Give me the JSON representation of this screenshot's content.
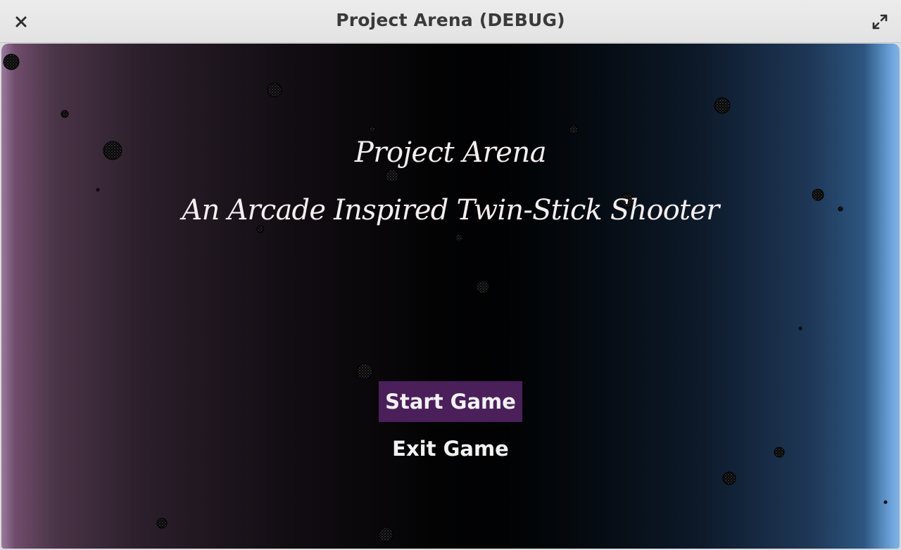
{
  "window": {
    "title": "Project Arena (DEBUG)"
  },
  "titlebar": {
    "close_icon": "close-icon",
    "maximize_icon": "expand-icon"
  },
  "game": {
    "title": "Project Arena",
    "subtitle": "An Arcade Inspired Twin-Stick Shooter"
  },
  "menu": {
    "start_label": "Start Game",
    "exit_label": "Exit Game"
  },
  "colors": {
    "start_highlight": "#4a1f5a",
    "menu_text": "#f2f2f2",
    "background_left": "#9a7ba0",
    "background_center": "#010203",
    "background_right": "#7fb4e6"
  }
}
